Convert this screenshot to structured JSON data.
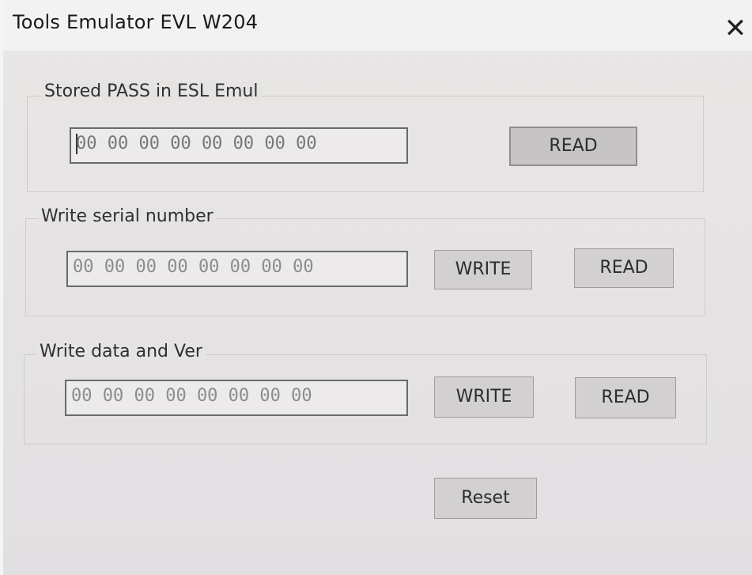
{
  "window": {
    "title": "Tools Emulator EVL W204",
    "close_glyph": "✕"
  },
  "sections": {
    "stored_pass": {
      "label": "Stored PASS in ESL Emul",
      "value": "00 00 00 00 00 00 00 00",
      "read_label": "READ"
    },
    "serial": {
      "label": "Write serial number",
      "value": "00 00 00 00 00 00 00 00",
      "write_label": "WRITE",
      "read_label": "READ"
    },
    "data_ver": {
      "label": "Write data and Ver",
      "value": "00 00 00 00 00 00 00 00",
      "write_label": "WRITE",
      "read_label": "READ"
    }
  },
  "reset_label": "Reset",
  "icons": {
    "close": "close-icon"
  }
}
